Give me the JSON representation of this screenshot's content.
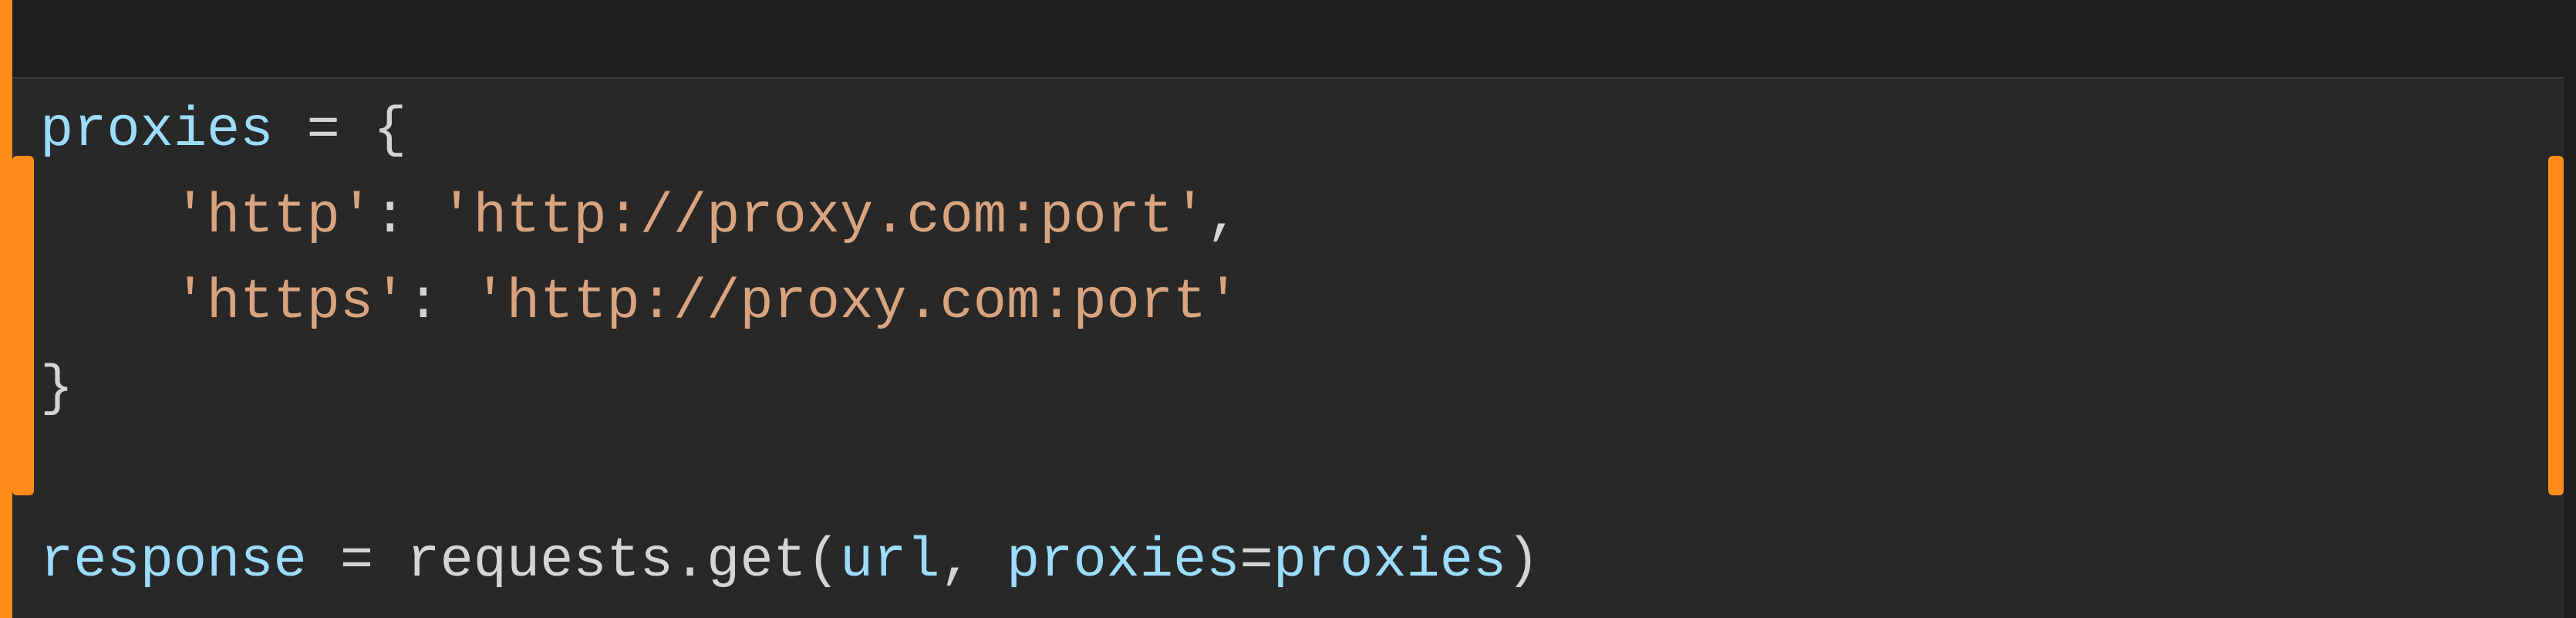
{
  "code": {
    "line1": {
      "var": "proxies",
      "op": " = ",
      "brace": "{"
    },
    "line2": {
      "indent": "    ",
      "key": "'http'",
      "colon": ": ",
      "value": "'http://proxy.com:port'",
      "comma": ","
    },
    "line3": {
      "indent": "    ",
      "key": "'https'",
      "colon": ": ",
      "value": "'http://proxy.com:port'"
    },
    "line4": {
      "brace": "}"
    },
    "line6": {
      "var": "response",
      "op": " = ",
      "call1": "requests.get(",
      "arg1": "url",
      "sep": ", ",
      "kw": "proxies",
      "eq": "=",
      "argvar": "proxies",
      "close": ")"
    }
  }
}
